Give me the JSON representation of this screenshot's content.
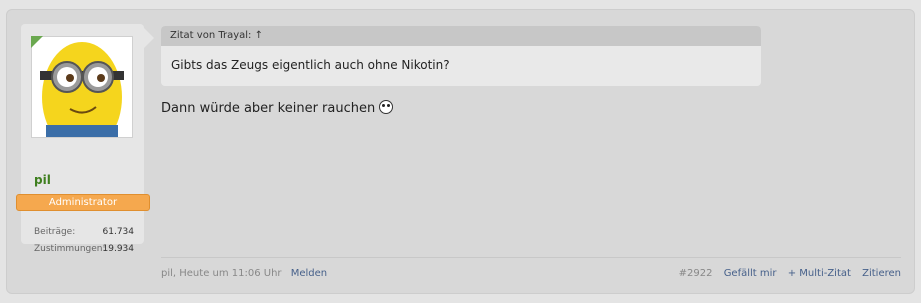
{
  "user": {
    "name": "pil",
    "role": "Administrator",
    "stats": [
      {
        "label": "Beiträge:",
        "value": "61.734"
      },
      {
        "label": "Zustimmungen:",
        "value": "19.934"
      }
    ]
  },
  "quote": {
    "header": "Zitat von Trayal: ↑",
    "text": "Gibts das Zeugs eigentlich auch ohne Nikotin?"
  },
  "message": "Dann würde aber keiner rauchen",
  "footer": {
    "author_time": "pil, Heute um 11:06 Uhr",
    "report": "Melden",
    "post_number": "#2922",
    "like": "Gefällt mir",
    "multiquote": "+ Multi-Zitat",
    "quote": "Zitieren"
  },
  "colors": {
    "role_badge": "#f5a84e",
    "username": "#3f7f1f",
    "link": "#46608a"
  }
}
